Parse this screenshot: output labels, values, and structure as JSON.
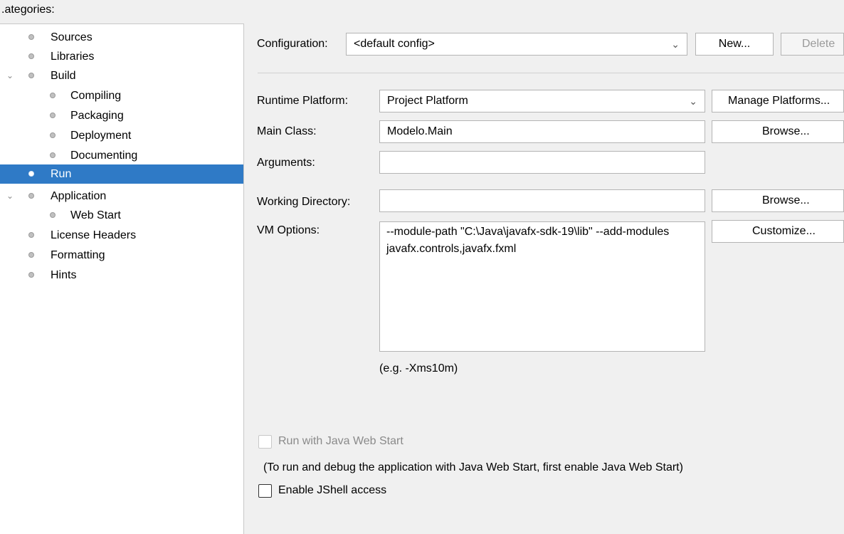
{
  "left_panel": {
    "header": ".ategories:",
    "items": [
      {
        "label": "Sources",
        "expanded": null,
        "selected": false
      },
      {
        "label": "Libraries",
        "expanded": null,
        "selected": false
      },
      {
        "label": "Build",
        "expanded": true,
        "selected": false
      },
      {
        "label": "Compiling",
        "expanded": null,
        "selected": false
      },
      {
        "label": "Packaging",
        "expanded": null,
        "selected": false
      },
      {
        "label": "Deployment",
        "expanded": null,
        "selected": false
      },
      {
        "label": "Documenting",
        "expanded": null,
        "selected": false
      },
      {
        "label": "Run",
        "expanded": null,
        "selected": true
      },
      {
        "label": "Application",
        "expanded": true,
        "selected": false
      },
      {
        "label": "Web Start",
        "expanded": null,
        "selected": false
      },
      {
        "label": "License Headers",
        "expanded": null,
        "selected": false
      },
      {
        "label": "Formatting",
        "expanded": null,
        "selected": false
      },
      {
        "label": "Hints",
        "expanded": null,
        "selected": false
      }
    ]
  },
  "configuration": {
    "label": "Configuration:",
    "value": "<default config>",
    "new_button": "New...",
    "delete_button": "Delete"
  },
  "runtime_platform": {
    "label": "Runtime Platform:",
    "value": "Project Platform",
    "manage_button": "Manage Platforms..."
  },
  "main_class": {
    "label": "Main Class:",
    "value": "Modelo.Main",
    "browse_button": "Browse..."
  },
  "arguments": {
    "label": "Arguments:",
    "value": ""
  },
  "working_directory": {
    "label": "Working Directory:",
    "value": "",
    "browse_button": "Browse..."
  },
  "vm_options": {
    "label": "VM Options:",
    "value": "--module-path \"C:\\Java\\javafx-sdk-19\\lib\" --add-modules javafx.controls,javafx.fxml",
    "customize_button": "Customize...",
    "hint": "(e.g. -Xms10m)"
  },
  "web_start": {
    "checkbox_label": "Run with Java Web Start",
    "checked": false,
    "enabled": false,
    "note": "(To run and debug the application with Java Web Start, first enable Java Web Start)"
  },
  "jshell": {
    "checkbox_label": "Enable JShell access",
    "checked": false
  },
  "icons": {
    "expand": "chevron-down-icon",
    "node": "bullet-icon",
    "dropdown": "chevron-down-icon"
  },
  "colors": {
    "selection": "#2f7ac6",
    "background": "#f0f0f0"
  }
}
